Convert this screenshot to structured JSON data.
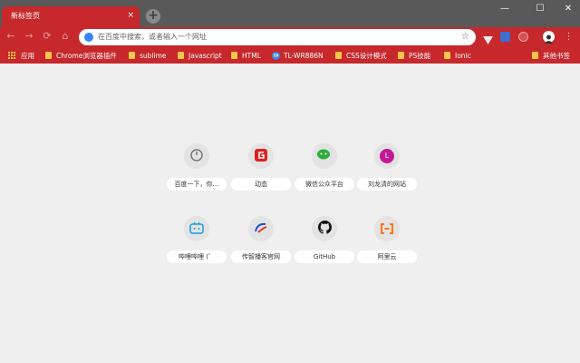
{
  "tab": {
    "title": "新标签页",
    "close": "×"
  },
  "titlebar": {
    "new_tab": "+",
    "minimize": "—",
    "maximize": "☐",
    "close": "✕"
  },
  "toolbar": {
    "back": "←",
    "forward": "→",
    "reload": "⟳",
    "home": "⌂",
    "omnibox_placeholder": "在百度中搜索，或者输入一个网址",
    "bookmark_star": "☆"
  },
  "bookmarks": {
    "apps_label": "应用",
    "items": [
      "Chrome浏览器插件",
      "sublime",
      "Javascript",
      "HTML",
      "TL-WR886N",
      "CSS设计模式",
      "PS技能",
      "Ionic"
    ],
    "tp_badge": "TP",
    "other_label": "其他书签"
  },
  "shortcuts": [
    {
      "title": "百度一下，你…",
      "icon": "baidu-icon"
    },
    {
      "title": "动态",
      "icon": "dongtai-icon"
    },
    {
      "title": "微信公众平台",
      "icon": "wechat-icon"
    },
    {
      "title": "刘龙清的网站",
      "icon": "letter-l-icon",
      "letter": "L"
    },
    {
      "title": "哔哩哔哩 (゜",
      "icon": "bilibili-icon"
    },
    {
      "title": "传智播客官网",
      "icon": "itcast-icon"
    },
    {
      "title": "GitHub",
      "icon": "github-icon"
    },
    {
      "title": "阿里云",
      "icon": "aliyun-icon"
    }
  ],
  "colors": {
    "accent": "#c6282b",
    "titlebar": "#595959",
    "page_bg": "#efefef"
  }
}
